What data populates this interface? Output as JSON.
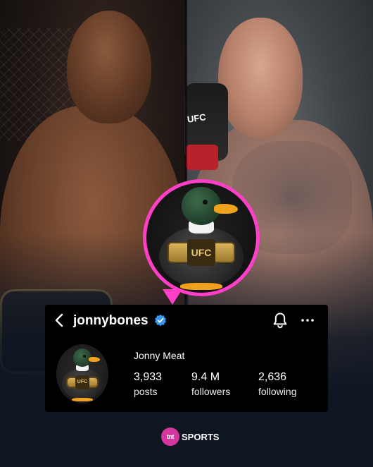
{
  "profile": {
    "username": "jonnybones",
    "display_name": "Jonny Meat",
    "stats": [
      {
        "value": "3,933",
        "label": "posts"
      },
      {
        "value": "9.4 M",
        "label": "followers"
      },
      {
        "value": "2,636",
        "label": "following"
      }
    ]
  },
  "glove_text": "UFC",
  "avatar": {
    "belt_text": "UFC"
  },
  "brand": {
    "logo": "tnt",
    "name": "SPORTS"
  },
  "colors": {
    "bubble_accent": "#ff3fc8",
    "verified": "#3897f0",
    "card_bg": "#000000",
    "brand": "#d4369f"
  },
  "icons": [
    "back-arrow-icon",
    "verified-badge-icon",
    "bell-icon",
    "more-options-icon"
  ]
}
